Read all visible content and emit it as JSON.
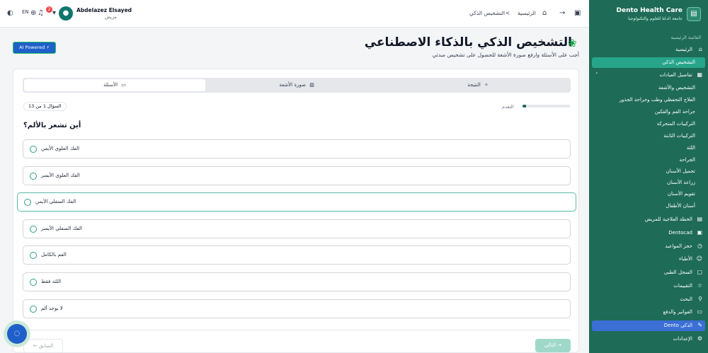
{
  "topbar": {
    "lang": "EN",
    "notification_count": "2",
    "user_name": "Abdelazez Elsayed",
    "user_role": "مريض",
    "breadcrumb_home": "الرئيسية",
    "breadcrumb_current": "التشخيص الذكي",
    "breadcrumb_sep": "<"
  },
  "sidebar": {
    "title": "Dento Health Care",
    "subtitle": "جامعة الدلتا للعلوم والتكنولوجيا",
    "section": "القائمة الرئيسية",
    "items": [
      {
        "label": "الرئيسية",
        "icon": "home-icon"
      },
      {
        "label": "التشخيص الذكي",
        "icon": ""
      },
      {
        "label": "تفاصيل العيادات",
        "icon": "clinic-icon"
      },
      {
        "label": "التشخيص والأشعة",
        "icon": ""
      },
      {
        "label": "العلاج التحفظي وطب وجراحة الجذور",
        "icon": ""
      },
      {
        "label": "جراحة الفم والفكين",
        "icon": ""
      },
      {
        "label": "التركيبات المتحركة",
        "icon": ""
      },
      {
        "label": "التركيبات الثابتة",
        "icon": ""
      },
      {
        "label": "اللثة",
        "icon": ""
      },
      {
        "label": "الجراحة",
        "icon": ""
      },
      {
        "label": "تجميل الأسنان",
        "icon": ""
      },
      {
        "label": "زراعة الأسنان",
        "icon": ""
      },
      {
        "label": "تقويم الأسنان",
        "icon": ""
      },
      {
        "label": "أسنان الأطفال",
        "icon": ""
      },
      {
        "label": "الخطة العلاجية للمريض",
        "icon": "plan-icon"
      },
      {
        "label": "Dentocad",
        "icon": "cad-icon"
      },
      {
        "label": "حجز المواعيد",
        "icon": "clock-icon"
      },
      {
        "label": "الأطباء",
        "icon": "doctors-icon"
      },
      {
        "label": "السجل الطبي",
        "icon": "record-icon"
      },
      {
        "label": "التقييمات",
        "icon": "rating-icon"
      },
      {
        "label": "البحث",
        "icon": "search-icon"
      },
      {
        "label": "الفواتير والدفع",
        "icon": "billing-icon"
      },
      {
        "label": "Dento الذكي",
        "icon": "ai-icon"
      },
      {
        "label": "الإعدادات",
        "icon": "settings-icon"
      }
    ]
  },
  "header": {
    "ai_badge": "AI Powered",
    "title": "التشخيص الذكي بالذكاء الاصطناعي",
    "subtitle": "أجب على الأسئلة وارفع صورة الأشعة للحصول على تشخيص مبدئي"
  },
  "tabs": [
    {
      "label": "النتيجة"
    },
    {
      "label": "صورة الأشعة"
    },
    {
      "label": "الأسئلة"
    }
  ],
  "progress": {
    "label": "التقدم",
    "fraction": 0.08
  },
  "question": {
    "counter": "السؤال 1 من 13",
    "text": "أين تشعر بالألم؟",
    "options": [
      "الفك العلوي الأيمن",
      "الفك العلوي الأيسر",
      "الفك السفلي الأيمن",
      "الفك السفلي الأيسر",
      "الفم بالكامل",
      "اللثة فقط",
      "لا يوجد ألم"
    ]
  },
  "nav": {
    "prev": "السابق",
    "next": "التالي"
  },
  "colors": {
    "sidebar": "#1e6b57",
    "accent": "#27a58b",
    "active_blue": "#3b6fd6"
  }
}
